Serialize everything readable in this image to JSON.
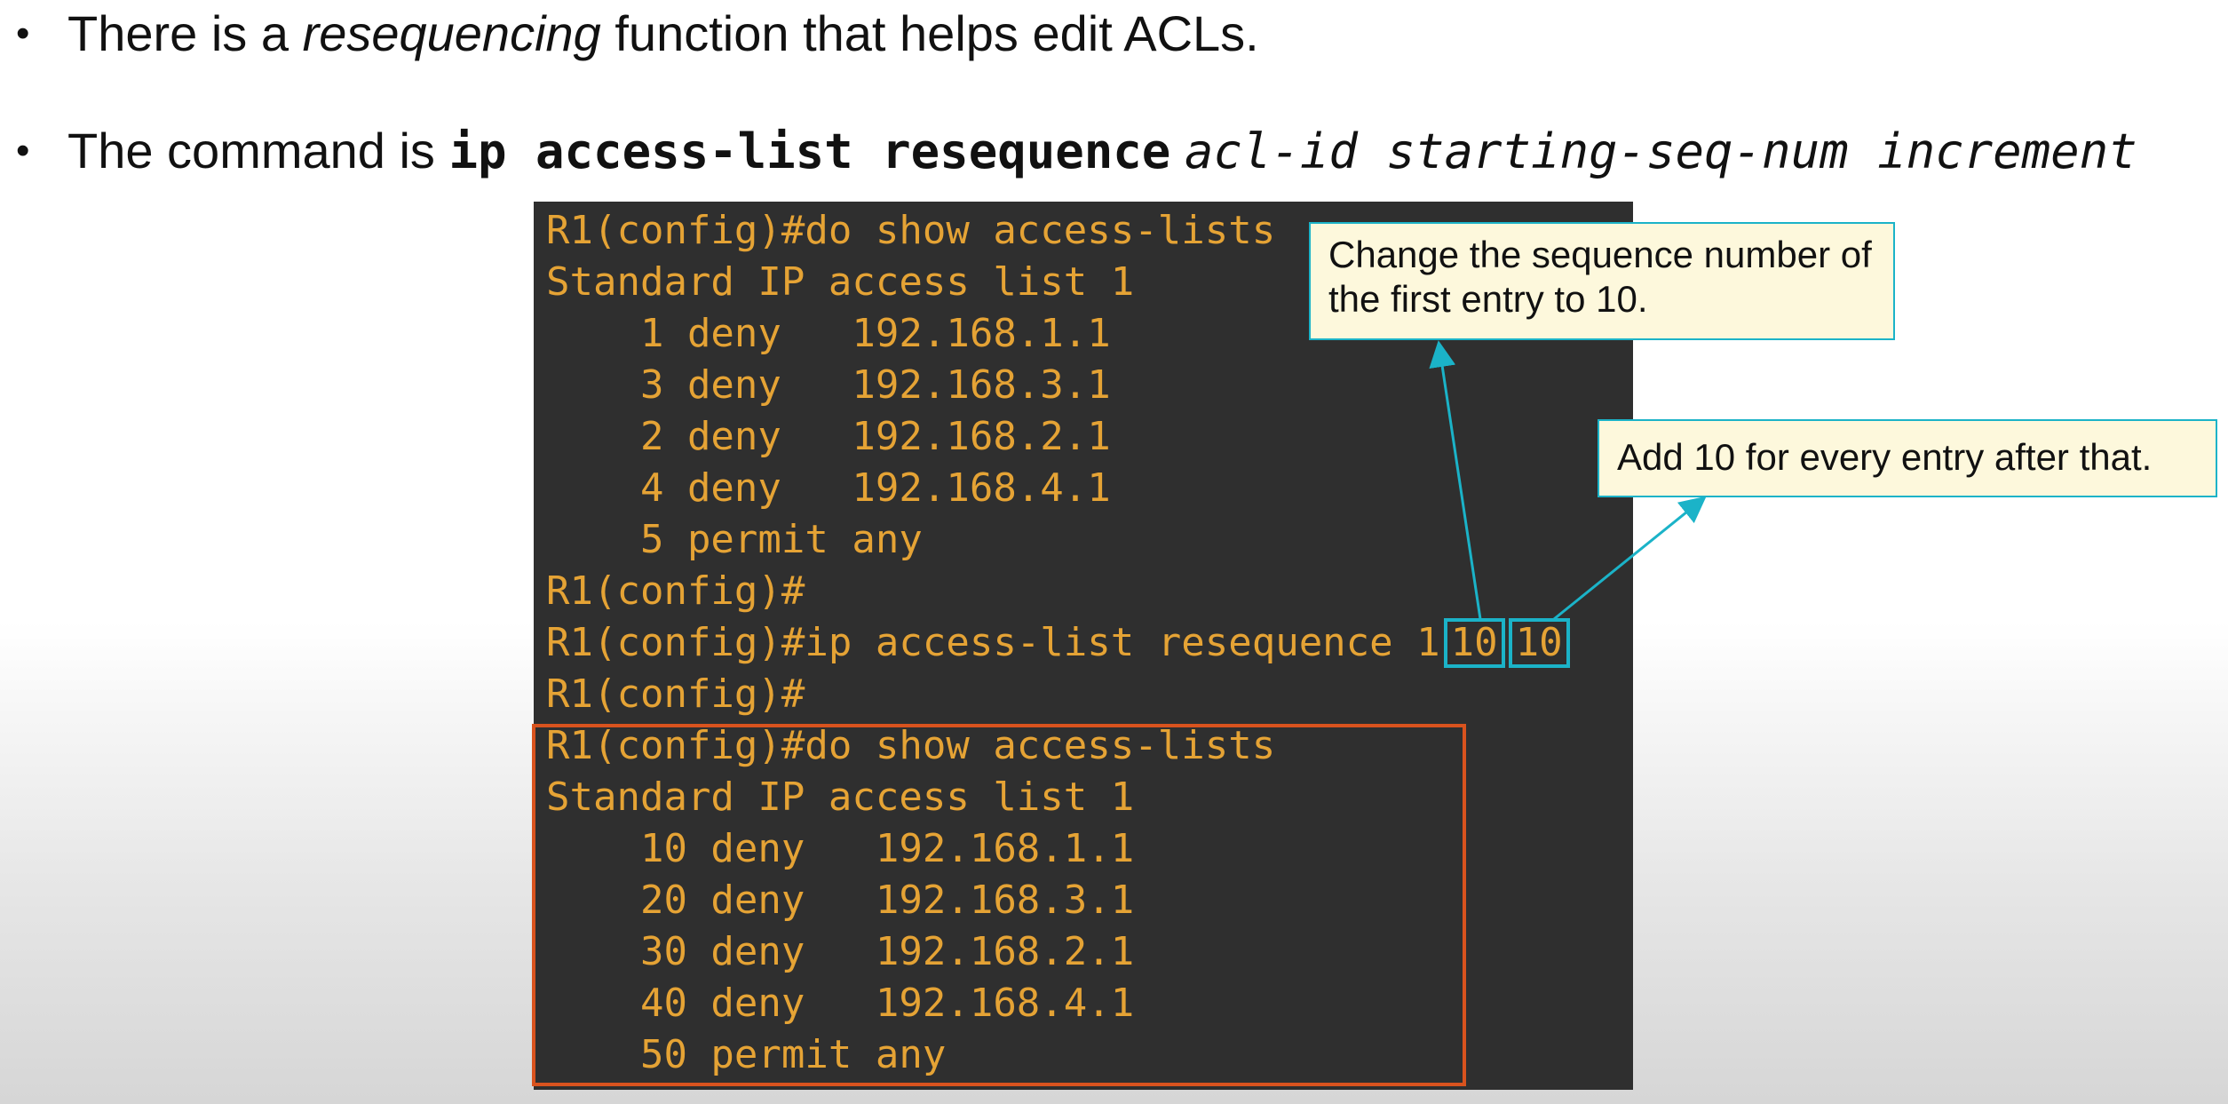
{
  "bullets": {
    "bullet_glyph": "•",
    "line1": {
      "before": "There is a ",
      "italic": "resequencing",
      "after": " function that helps edit ACLs."
    },
    "line2": {
      "before": "The command is ",
      "command": "ip access-list resequence",
      "args": "acl-id starting-seq-num increment"
    }
  },
  "terminal": {
    "lines": [
      "R1(config)#do show access-lists",
      "Standard IP access list 1",
      "    1 deny   192.168.1.1",
      "    3 deny   192.168.3.1",
      "    2 deny   192.168.2.1",
      "    4 deny   192.168.4.1",
      "    5 permit any",
      "R1(config)#",
      "R1(config)#ip access-list resequence 1",
      "R1(config)#",
      "R1(config)#do show access-lists",
      "Standard IP access list 1",
      "    10 deny   192.168.1.1",
      "    20 deny   192.168.3.1",
      "    30 deny   192.168.2.1",
      "    40 deny   192.168.4.1",
      "    50 permit any"
    ],
    "starting_seq": "10",
    "increment": "10",
    "text_color": "#e5a335",
    "background": "#2f2f2f"
  },
  "callouts": {
    "starting_seq_note": "Change the sequence number of the first entry to 10.",
    "increment_note": "Add 10 for every entry after that."
  },
  "colors": {
    "highlight_cyan": "#1bb3c8",
    "result_box_orange": "#d9531e",
    "callout_bg": "#fdf8dc"
  }
}
